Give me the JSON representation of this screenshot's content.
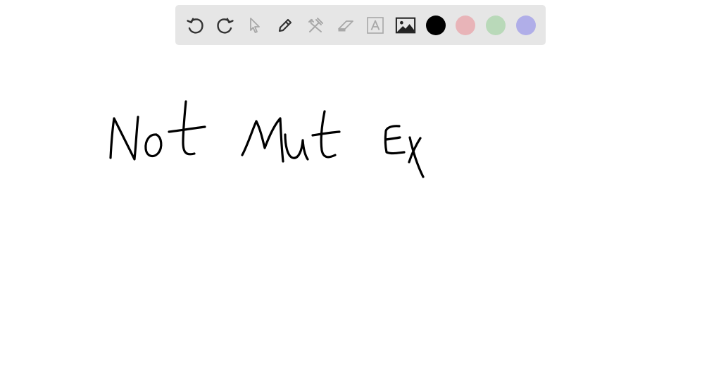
{
  "toolbar": {
    "tools": [
      {
        "name": "undo",
        "icon": "undo-icon",
        "enabled": true
      },
      {
        "name": "redo",
        "icon": "redo-icon",
        "enabled": true
      },
      {
        "name": "select",
        "icon": "pointer-icon",
        "enabled": false
      },
      {
        "name": "pen",
        "icon": "pencil-icon",
        "enabled": true
      },
      {
        "name": "tools",
        "icon": "hammer-wrench-icon",
        "enabled": false
      },
      {
        "name": "eraser",
        "icon": "eraser-icon",
        "enabled": false
      },
      {
        "name": "text",
        "icon": "text-box-icon",
        "enabled": false
      },
      {
        "name": "image",
        "icon": "image-icon",
        "enabled": true
      }
    ],
    "colors": [
      {
        "name": "black",
        "hex": "#000000",
        "selected": true
      },
      {
        "name": "pink",
        "hex": "#e8b4b8",
        "selected": false
      },
      {
        "name": "green",
        "hex": "#b9d9b9",
        "selected": false
      },
      {
        "name": "lavender",
        "hex": "#b0aee8",
        "selected": false
      }
    ],
    "icon_color": "#333333",
    "disabled_icon_color": "#a8a8a8"
  },
  "canvas": {
    "handwriting": "Not Mut Ex",
    "ink_color": "#000000"
  }
}
